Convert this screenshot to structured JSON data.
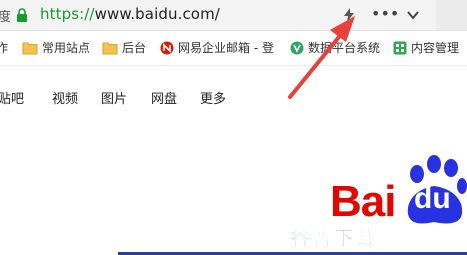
{
  "address_bar": {
    "prefix": "度",
    "url_scheme": "https://",
    "url_rest": "www.baidu.com/",
    "icons": [
      "lock-icon",
      "bolt-icon",
      "more-icon",
      "chevron-down-icon"
    ],
    "more_glyph": "•••"
  },
  "bookmarks": [
    {
      "label": "作",
      "icon": "none"
    },
    {
      "label": "常用站点",
      "icon": "folder-icon"
    },
    {
      "label": "后台",
      "icon": "folder-icon"
    },
    {
      "label": "网易企业邮箱 - 登",
      "icon": "netease-icon"
    },
    {
      "label": "数据平台系统",
      "icon": "v-icon"
    },
    {
      "label": "内容管理",
      "icon": "grid-icon"
    }
  ],
  "page_nav": [
    "贴吧",
    "视频",
    "图片",
    "网盘",
    "更多"
  ],
  "logo": {
    "bai": "Bai",
    "du": "du",
    "brand_red": "#e10600",
    "brand_blue": "#2932e1"
  },
  "watermark": "谷普下载",
  "colors": {
    "url_green": "#1a9a31",
    "arrow_red": "#e8403a",
    "folder_yellow": "#f2c14e"
  }
}
